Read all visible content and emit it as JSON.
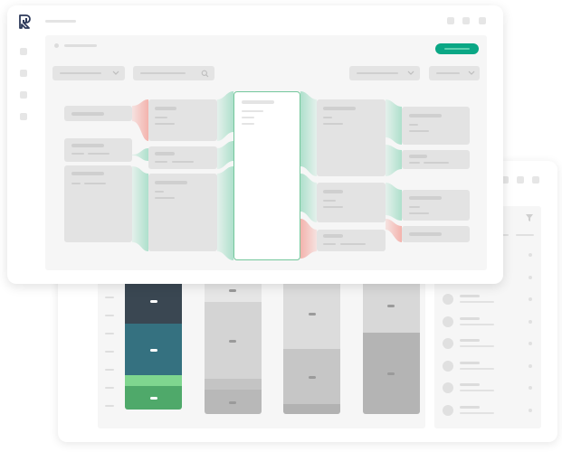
{
  "app": {
    "logo_icon": "document-chart-logo-icon",
    "primary_color": "#0aa785",
    "positive_flow_color": "#aee0cc",
    "negative_flow_color": "#f4b3ad"
  },
  "back_panel": {
    "bar_columns": [
      {
        "segments": [
          {
            "color": "#3a4752",
            "fraction": 0.33
          },
          {
            "color": "#357180",
            "fraction": 0.38
          },
          {
            "color": "#7fd68f",
            "fraction": 0.08
          },
          {
            "color": "#4fa96a",
            "fraction": 0.17
          }
        ]
      },
      {
        "segments": [
          {
            "color": "#e6e6e6",
            "fraction": 0.17
          },
          {
            "color": "#d4d4d4",
            "fraction": 0.57
          },
          {
            "color": "#c4c4c4",
            "fraction": 0.08
          },
          {
            "color": "#b8b8b8",
            "fraction": 0.18
          }
        ]
      },
      {
        "segments": [
          {
            "color": "#dcdcdc",
            "fraction": 0.52
          },
          {
            "color": "#c6c6c6",
            "fraction": 0.41
          },
          {
            "color": "#b2b2b2",
            "fraction": 0.07
          }
        ]
      },
      {
        "segments": [
          {
            "color": "#d8d8d8",
            "fraction": 0.4
          },
          {
            "color": "#b4b4b4",
            "fraction": 0.6
          }
        ]
      }
    ],
    "side_list_count": 8,
    "filter_icon": "filter-icon"
  },
  "front_panel": {
    "sidebar_icons": [
      "nav-item-1-icon",
      "nav-item-2-icon",
      "nav-item-3-icon",
      "nav-item-4-icon"
    ],
    "window_controls": [
      "control-1-icon",
      "control-2-icon",
      "control-3-icon"
    ],
    "search_icon": "search-icon",
    "dropdown_icon": "chevron-down-icon"
  }
}
